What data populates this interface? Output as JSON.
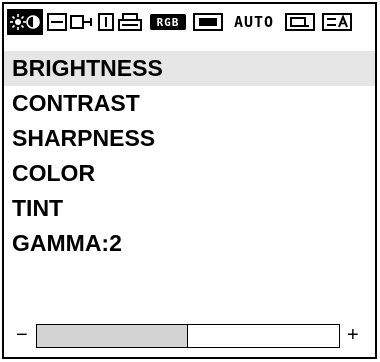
{
  "tabs": [
    {
      "icon": "brightness-contrast-icon",
      "active": true
    },
    {
      "icon": "size-position-icon",
      "active": false
    },
    {
      "icon": "phase-clock-icon",
      "active": false
    },
    {
      "label": "RGB",
      "active": false
    },
    {
      "icon": "screen-icon",
      "active": false
    },
    {
      "label": "AUTO",
      "active": false
    },
    {
      "icon": "source-icon",
      "active": false
    },
    {
      "icon": "setup-icon",
      "active": false
    }
  ],
  "menu": {
    "items": [
      {
        "label": "BRIGHTNESS",
        "selected": true
      },
      {
        "label": "CONTRAST",
        "selected": false
      },
      {
        "label": "SHARPNESS",
        "selected": false
      },
      {
        "label": "COLOR",
        "selected": false
      },
      {
        "label": "TINT",
        "selected": false
      },
      {
        "label": "GAMMA:2",
        "selected": false
      }
    ]
  },
  "slider": {
    "minus_label": "−",
    "plus_label": "+",
    "level_fraction": 0.5
  },
  "colors": {
    "selection_bg": "#e6e6e6",
    "slider_fill": "#d3d3d3",
    "foreground": "#000000"
  }
}
